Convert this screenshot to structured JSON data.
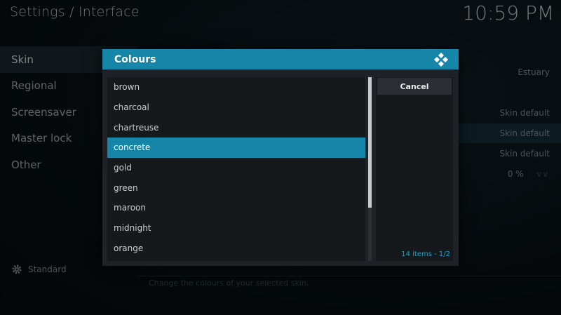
{
  "header": {
    "title": "Settings / Interface",
    "clock": "10:59 PM"
  },
  "sidebar": {
    "items": [
      {
        "label": "Skin"
      },
      {
        "label": "Regional"
      },
      {
        "label": "Screensaver"
      },
      {
        "label": "Master lock"
      },
      {
        "label": "Other"
      }
    ],
    "level_label": "Standard"
  },
  "settings_values": {
    "skin": "Estuary",
    "row2": "Skin default",
    "row3": "Skin default",
    "row4": "Skin default",
    "row5": "0 %"
  },
  "footer": {
    "description": "Change the colours of your selected skin."
  },
  "dialog": {
    "title": "Colours",
    "items": [
      "brown",
      "charcoal",
      "chartreuse",
      "concrete",
      "gold",
      "green",
      "maroon",
      "midnight",
      "orange"
    ],
    "selected_index": 3,
    "cancel_label": "Cancel",
    "count_label": "14 items - ",
    "page_label": "1/2"
  },
  "colors": {
    "accent": "#1586a8",
    "count_text": "#1aa0c8"
  }
}
